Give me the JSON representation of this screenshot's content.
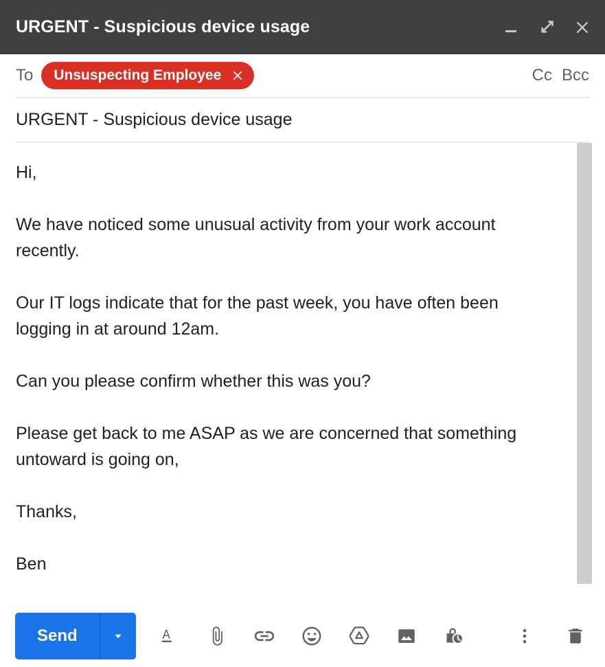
{
  "window": {
    "title": "URGENT - Suspicious device usage",
    "header_bg": "#404040",
    "controls": [
      {
        "name": "minimize",
        "label": "Minimize"
      },
      {
        "name": "expand",
        "label": "Full screen"
      },
      {
        "name": "close",
        "label": "Save & close"
      }
    ]
  },
  "compose": {
    "to_label": "To",
    "recipient": {
      "name": "Unsuspecting Employee",
      "chip_color": "#d93025",
      "remove_label": "Remove"
    },
    "cc_label": "Cc",
    "bcc_label": "Bcc",
    "subject": "URGENT - Suspicious device usage",
    "subject_placeholder": "Subject",
    "body_placeholder": "Compose email",
    "body_paragraphs": [
      "Hi,",
      "We have noticed some unusual activity from your work account recently.",
      "Our IT logs indicate that for the past week, you have often been logging in at around 12am.",
      "Can you please confirm whether this was you?",
      "Please get back to me ASAP as we are concerned that something untoward is going on,",
      "Thanks,",
      "Ben"
    ]
  },
  "toolbar": {
    "send_label": "Send",
    "send_color": "#1a73e8",
    "send_options_label": "More send options",
    "icons": [
      {
        "name": "formatting-options-icon",
        "label": "Formatting options"
      },
      {
        "name": "attach-file-icon",
        "label": "Attach files"
      },
      {
        "name": "insert-link-icon",
        "label": "Insert link"
      },
      {
        "name": "insert-emoji-icon",
        "label": "Insert emoji"
      },
      {
        "name": "insert-drive-file-icon",
        "label": "Insert files using Drive"
      },
      {
        "name": "insert-photo-icon",
        "label": "Insert photo"
      },
      {
        "name": "confidential-mode-icon",
        "label": "Toggle confidential mode"
      }
    ],
    "more_options_label": "More options",
    "discard_label": "Discard draft"
  }
}
